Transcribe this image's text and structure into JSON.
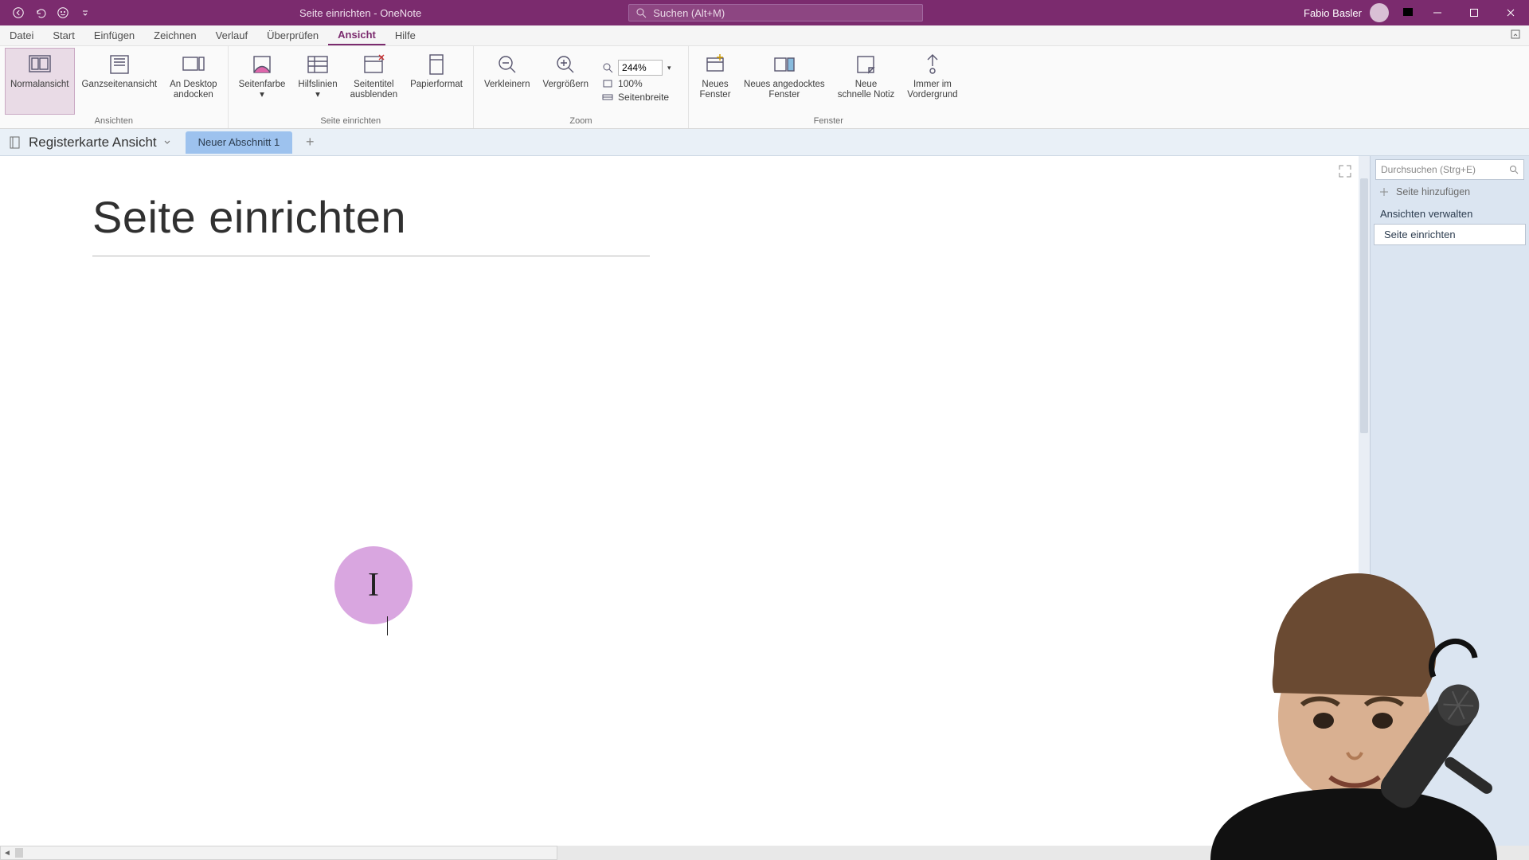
{
  "titlebar": {
    "doc": "Seite einrichten",
    "app": "OneNote",
    "separator": "  -  ",
    "search_placeholder": "Suchen (Alt+M)",
    "user_name": "Fabio Basler"
  },
  "menutabs": [
    "Datei",
    "Start",
    "Einfügen",
    "Zeichnen",
    "Verlauf",
    "Überprüfen",
    "Ansicht",
    "Hilfe"
  ],
  "menutab_active_index": 6,
  "ribbon": {
    "groups": [
      {
        "label": "Ansichten",
        "buttons": [
          {
            "id": "normal-view",
            "cap": "Normalansicht",
            "selected": true
          },
          {
            "id": "fullpage-view",
            "cap": "Ganzseitenansicht"
          },
          {
            "id": "dock-desktop",
            "cap": "An Desktop\nandocken"
          }
        ]
      },
      {
        "label": "Seite einrichten",
        "buttons": [
          {
            "id": "page-color",
            "cap": "Seitenfarbe",
            "dropdown": true
          },
          {
            "id": "rule-lines",
            "cap": "Hilfslinien",
            "dropdown": true
          },
          {
            "id": "hide-title",
            "cap": "Seitentitel\nausblenden"
          },
          {
            "id": "paper-size",
            "cap": "Papierformat"
          }
        ]
      },
      {
        "label": "Zoom",
        "buttons_left": [
          {
            "id": "zoom-out",
            "cap": "Verkleinern"
          },
          {
            "id": "zoom-in",
            "cap": "Vergrößern"
          }
        ],
        "zoom_value": "244%",
        "zoom_100": "100%",
        "zoom_pagewidth": "Seitenbreite"
      },
      {
        "label": "Fenster",
        "buttons": [
          {
            "id": "new-window",
            "cap": "Neues\nFenster"
          },
          {
            "id": "new-docked",
            "cap": "Neues angedocktes\nFenster"
          },
          {
            "id": "quick-note",
            "cap": "Neue\nschnelle Notiz"
          },
          {
            "id": "always-on-top",
            "cap": "Immer im\nVordergrund"
          }
        ]
      }
    ]
  },
  "notebookbar": {
    "notebook_name": "Registerkarte Ansicht",
    "section_tab": "Neuer Abschnitt 1"
  },
  "page": {
    "title": "Seite einrichten"
  },
  "pagepane": {
    "search_placeholder": "Durchsuchen (Strg+E)",
    "add_page": "Seite hinzufügen",
    "items": [
      "Ansichten verwalten",
      "Seite einrichten"
    ],
    "active_index": 1
  }
}
